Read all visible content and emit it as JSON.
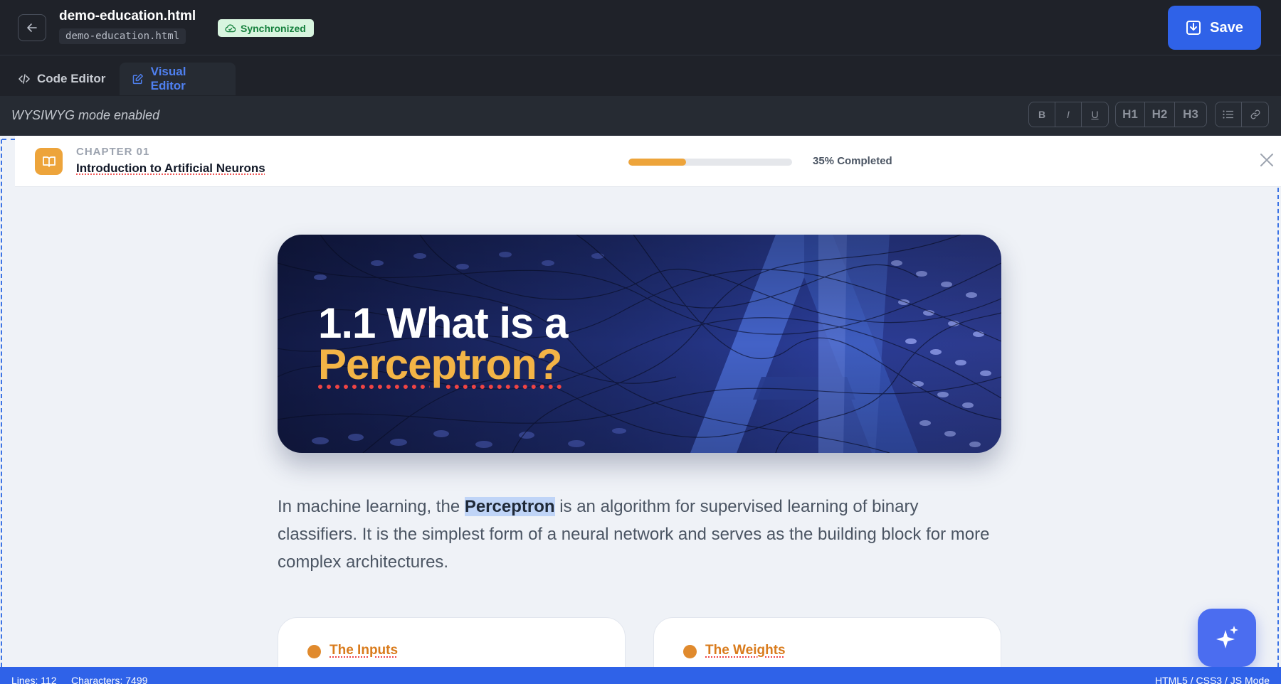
{
  "header": {
    "back_icon": "arrow-left-icon",
    "title": "demo-education.html",
    "path": "demo-education.html",
    "sync_status": "Synchronized",
    "sync_icon": "cloud-check-icon",
    "save_label": "Save",
    "save_icon": "save-icon"
  },
  "tabs": [
    {
      "label": "Code Editor",
      "icon": "code-icon",
      "active": false
    },
    {
      "label": "Visual Editor",
      "icon": "edit-icon",
      "active": true
    }
  ],
  "toolbar": {
    "mode_text": "WYSIWYG mode enabled",
    "buttons": {
      "bold": "B",
      "italic": "I",
      "underline": "U",
      "h1": "H1",
      "h2": "H2",
      "h3": "H3"
    },
    "list_icon": "list-icon",
    "link_icon": "link-icon"
  },
  "chapter": {
    "icon": "book-icon",
    "label": "CHAPTER 01",
    "title": "Introduction to Artificial Neurons",
    "progress_percent": 35,
    "progress_text": "35% Completed",
    "close_icon": "close-icon"
  },
  "hero": {
    "line1": "1.1 What is a",
    "line2": "Perceptron?",
    "background_text": "AI"
  },
  "intro": {
    "before": "In machine learning, the ",
    "highlight": "Perceptron",
    "after": " is an algorithm for supervised learning of binary classifiers. It is the simplest form of a neural network and serves as the building block for more complex architectures."
  },
  "cards": [
    {
      "title": "The Inputs"
    },
    {
      "title": "The Weights"
    }
  ],
  "ai_button_icon": "sparkles-icon",
  "status": {
    "lines": "Lines: 112",
    "characters": "Characters: 7499",
    "mode": "HTML5 / CSS3 / JS Mode"
  },
  "colors": {
    "accent_blue": "#2f62e8",
    "accent_orange": "#eda43b",
    "hero_highlight": "#f3b446",
    "background_dark": "#1f2229"
  }
}
